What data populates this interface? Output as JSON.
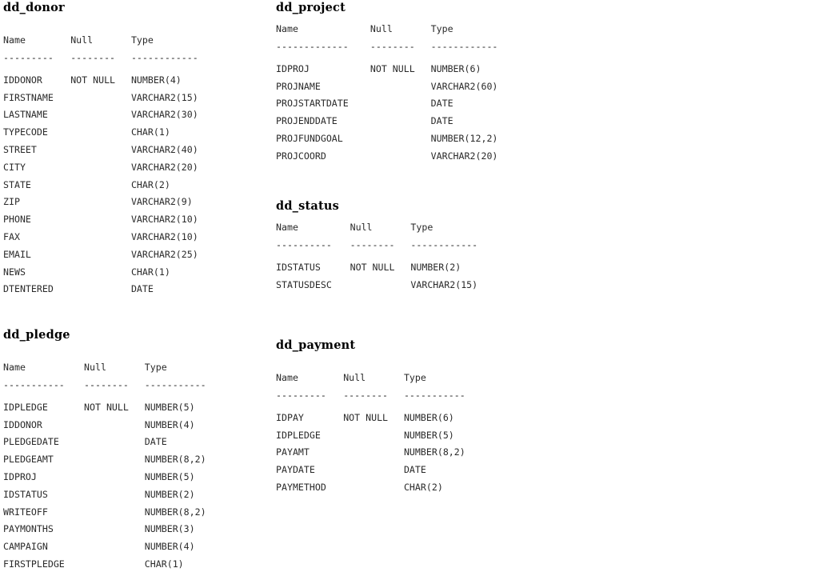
{
  "document": {
    "kind": "database-schema-listing",
    "column_headers": [
      "Name",
      "Null",
      "Type"
    ],
    "not_null_label": "NOT NULL",
    "background_color": "#ffffff",
    "text_color": "#2a2a2a"
  },
  "tables": [
    {
      "id": "dd_donor",
      "name": "dd_donor",
      "title_gap": "large",
      "rules": [
        "---------",
        "--------",
        "------------"
      ],
      "columns": [
        {
          "name": "IDDONOR",
          "null": "NOT NULL",
          "type": "NUMBER(4)"
        },
        {
          "name": "FIRSTNAME",
          "null": "",
          "type": "VARCHAR2(15)"
        },
        {
          "name": "LASTNAME",
          "null": "",
          "type": "VARCHAR2(30)"
        },
        {
          "name": "TYPECODE",
          "null": "",
          "type": "CHAR(1)"
        },
        {
          "name": "STREET",
          "null": "",
          "type": "VARCHAR2(40)"
        },
        {
          "name": "CITY",
          "null": "",
          "type": "VARCHAR2(20)"
        },
        {
          "name": "STATE",
          "null": "",
          "type": "CHAR(2)"
        },
        {
          "name": "ZIP",
          "null": "",
          "type": "VARCHAR2(9)"
        },
        {
          "name": "PHONE",
          "null": "",
          "type": "VARCHAR2(10)"
        },
        {
          "name": "FAX",
          "null": "",
          "type": "VARCHAR2(10)"
        },
        {
          "name": "EMAIL",
          "null": "",
          "type": "VARCHAR2(25)"
        },
        {
          "name": "NEWS",
          "null": "",
          "type": "CHAR(1)"
        },
        {
          "name": "DTENTERED",
          "null": "",
          "type": "DATE"
        }
      ]
    },
    {
      "id": "dd_project",
      "name": "dd_project",
      "title_gap": "small",
      "rules": [
        "-------------",
        "--------",
        "------------"
      ],
      "columns": [
        {
          "name": "IDPROJ",
          "null": "NOT NULL",
          "type": "NUMBER(6)"
        },
        {
          "name": "PROJNAME",
          "null": "",
          "type": "VARCHAR2(60)"
        },
        {
          "name": "PROJSTARTDATE",
          "null": "",
          "type": "DATE"
        },
        {
          "name": "PROJENDDATE",
          "null": "",
          "type": "DATE"
        },
        {
          "name": "PROJFUNDGOAL",
          "null": "",
          "type": "NUMBER(12,2)"
        },
        {
          "name": "PROJCOORD",
          "null": "",
          "type": "VARCHAR2(20)"
        }
      ]
    },
    {
      "id": "dd_status",
      "name": "dd_status",
      "title_gap": "small",
      "rules": [
        "----------",
        "--------",
        "------------"
      ],
      "columns": [
        {
          "name": "IDSTATUS",
          "null": "NOT NULL",
          "type": "NUMBER(2)"
        },
        {
          "name": "STATUSDESC",
          "null": "",
          "type": "VARCHAR2(15)"
        }
      ]
    },
    {
      "id": "dd_pledge",
      "name": "dd_pledge",
      "title_gap": "large",
      "rules": [
        "-----------",
        "--------",
        "-----------"
      ],
      "columns": [
        {
          "name": "IDPLEDGE",
          "null": "NOT NULL",
          "type": "NUMBER(5)"
        },
        {
          "name": "IDDONOR",
          "null": "",
          "type": "NUMBER(4)"
        },
        {
          "name": "PLEDGEDATE",
          "null": "",
          "type": "DATE"
        },
        {
          "name": "PLEDGEAMT",
          "null": "",
          "type": "NUMBER(8,2)"
        },
        {
          "name": "IDPROJ",
          "null": "",
          "type": "NUMBER(5)"
        },
        {
          "name": "IDSTATUS",
          "null": "",
          "type": "NUMBER(2)"
        },
        {
          "name": "WRITEOFF",
          "null": "",
          "type": "NUMBER(8,2)"
        },
        {
          "name": "PAYMONTHS",
          "null": "",
          "type": "NUMBER(3)"
        },
        {
          "name": "CAMPAIGN",
          "null": "",
          "type": "NUMBER(4)"
        },
        {
          "name": "FIRSTPLEDGE",
          "null": "",
          "type": "CHAR(1)"
        }
      ]
    },
    {
      "id": "dd_payment",
      "name": "dd_payment",
      "title_gap": "large",
      "rules": [
        "---------",
        "--------",
        "-----------"
      ],
      "columns": [
        {
          "name": "IDPAY",
          "null": "NOT NULL",
          "type": "NUMBER(6)"
        },
        {
          "name": "IDPLEDGE",
          "null": "",
          "type": "NUMBER(5)"
        },
        {
          "name": "PAYAMT",
          "null": "",
          "type": "NUMBER(8,2)"
        },
        {
          "name": "PAYDATE",
          "null": "",
          "type": "DATE"
        },
        {
          "name": "PAYMETHOD",
          "null": "",
          "type": "CHAR(2)"
        }
      ]
    }
  ]
}
